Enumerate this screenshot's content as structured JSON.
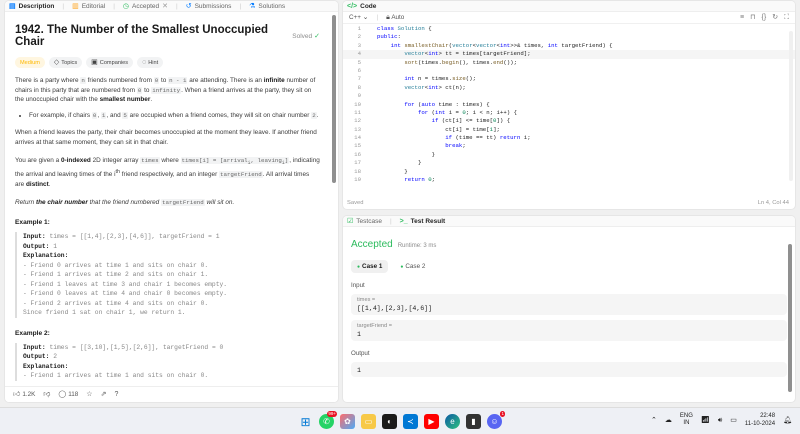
{
  "left_tabs": [
    {
      "label": "Description",
      "icon": "document-icon",
      "active": true
    },
    {
      "label": "Editorial",
      "icon": "book-icon"
    },
    {
      "label": "Accepted",
      "icon": "clock-icon"
    },
    {
      "label": "Submissions",
      "icon": "history-icon"
    },
    {
      "label": "Solutions",
      "icon": "flask-icon"
    }
  ],
  "problem": {
    "title": "1942. The Number of the Smallest Unoccupied Chair",
    "status": "Solved",
    "difficulty": "Medium",
    "chips": [
      "Topics",
      "Companies",
      "Hint"
    ],
    "p1a": "There is a party where ",
    "p1_n": "n",
    "p1b": " friends numbered from ",
    "p1_zero": "0",
    "p1c": " to ",
    "p1_nm1": "n - 1",
    "p1d": " are attending. There is an ",
    "p1_inf": "infinite",
    "p1e": " number of chairs in this party that are numbered from ",
    "p1_zero2": "0",
    "p1f": " to ",
    "p1_infinity": "infinity",
    "p1g": ". When a friend arrives at the party, they sit on the unoccupied chair with the ",
    "p1_smallest": "smallest number",
    "p1h": ".",
    "bullet_a": "For example, if chairs ",
    "bullet_0": "0",
    "bullet_1": "1",
    "bullet_5": "5",
    "bullet_b": " are occupied when a friend comes, they will sit on chair number ",
    "bullet_2": "2",
    "bullet_c": ".",
    "bullet_and": ", and ",
    "comma": ", ",
    "p2": "When a friend leaves the party, their chair becomes unoccupied at the moment they leave. If another friend arrives at that same moment, they can sit in that chair.",
    "p3a": "You are given a ",
    "p3_bold": "0-indexed",
    "p3b": " 2D integer array ",
    "p3_times": "times",
    "p3c": " where ",
    "p3_timesi": "times[i] = [arrival",
    "p3_sub_i": "i",
    "p3_leaving": ", leaving",
    "p3_close": "]",
    "p3d": ", indicating the arrival and leaving times of the ",
    "p3_ith": "i",
    "p3_th": "th",
    "p3e": " friend respectively, and an integer ",
    "p3_target": "targetFriend",
    "p3f": ". All arrival times are ",
    "p3_distinct": "distinct",
    "p3g": ".",
    "p4a": "Return ",
    "p4_bold": "the chair number",
    "p4b": " that the friend numbered ",
    "p4_target": "targetFriend",
    "p4c": " will sit on."
  },
  "examples": [
    {
      "title": "Example 1:",
      "input_label": "Input:",
      "input": " times = [[1,4],[2,3],[4,6]], targetFriend = 1",
      "output_label": "Output:",
      "output": " 1",
      "expl_label": "Explanation:",
      "lines": [
        "- Friend 0 arrives at time 1 and sits on chair 0.",
        "- Friend 1 arrives at time 2 and sits on chair 1.",
        "- Friend 1 leaves at time 3 and chair 1 becomes empty.",
        "- Friend 0 leaves at time 4 and chair 0 becomes empty.",
        "- Friend 2 arrives at time 4 and sits on chair 0.",
        "Since friend 1 sat on chair 1, we return 1."
      ]
    },
    {
      "title": "Example 2:",
      "input_label": "Input:",
      "input": " times = [[3,10],[1,5],[2,6]], targetFriend = 0",
      "output_label": "Output:",
      "output": " 2",
      "expl_label": "Explanation:",
      "lines": [
        "- Friend 1 arrives at time 1 and sits on chair 0."
      ]
    }
  ],
  "footer": {
    "likes": "1.2K",
    "comments": "118"
  },
  "code_panel": {
    "title": "Code",
    "language": "C++",
    "mode": "Auto",
    "status": "Saved",
    "cursor": "Ln 4, Col 44",
    "lines": [
      {
        "n": "1",
        "code": "class Solution {"
      },
      {
        "n": "2",
        "code": "public:"
      },
      {
        "n": "3",
        "code": "    int smallestChair(vector<vector<int>>& times, int targetFriend) {"
      },
      {
        "n": "4",
        "code": "        vector<int> tt = times[targetFriend];"
      },
      {
        "n": "5",
        "code": "        sort(times.begin(), times.end());"
      },
      {
        "n": "6",
        "code": ""
      },
      {
        "n": "7",
        "code": "        int n = times.size();"
      },
      {
        "n": "8",
        "code": "        vector<int> ct(n);"
      },
      {
        "n": "9",
        "code": ""
      },
      {
        "n": "10",
        "code": "        for (auto time : times) {"
      },
      {
        "n": "11",
        "code": "            for (int i = 0; i < n; i++) {"
      },
      {
        "n": "12",
        "code": "                if (ct[i] <= time[0]) {"
      },
      {
        "n": "13",
        "code": "                    ct[i] = time[1];"
      },
      {
        "n": "14",
        "code": "                    if (time == tt) return i;"
      },
      {
        "n": "15",
        "code": "                    break;"
      },
      {
        "n": "16",
        "code": "                }"
      },
      {
        "n": "17",
        "code": "            }"
      },
      {
        "n": "18",
        "code": "        }"
      },
      {
        "n": "19",
        "code": "        return 0;"
      }
    ]
  },
  "result_panel": {
    "tabs": [
      {
        "label": "Testcase",
        "icon": "checkbox-icon"
      },
      {
        "label": "Test Result",
        "icon": "terminal-icon",
        "active": true
      }
    ],
    "verdict": "Accepted",
    "runtime": "Runtime: 3 ms",
    "cases": [
      "Case 1",
      "Case 2"
    ],
    "input_label": "Input",
    "times_key": "times =",
    "times_val": "[[1,4],[2,3],[4,6]]",
    "target_key": "targetFriend =",
    "target_val": "1",
    "output_label": "Output",
    "output_val": "1"
  },
  "taskbar": {
    "lang_top": "ENG",
    "lang_bottom": "IN",
    "time": "22:48",
    "date": "11-10-2024",
    "whatsapp_badge": "99+",
    "discord_badge": "1"
  }
}
